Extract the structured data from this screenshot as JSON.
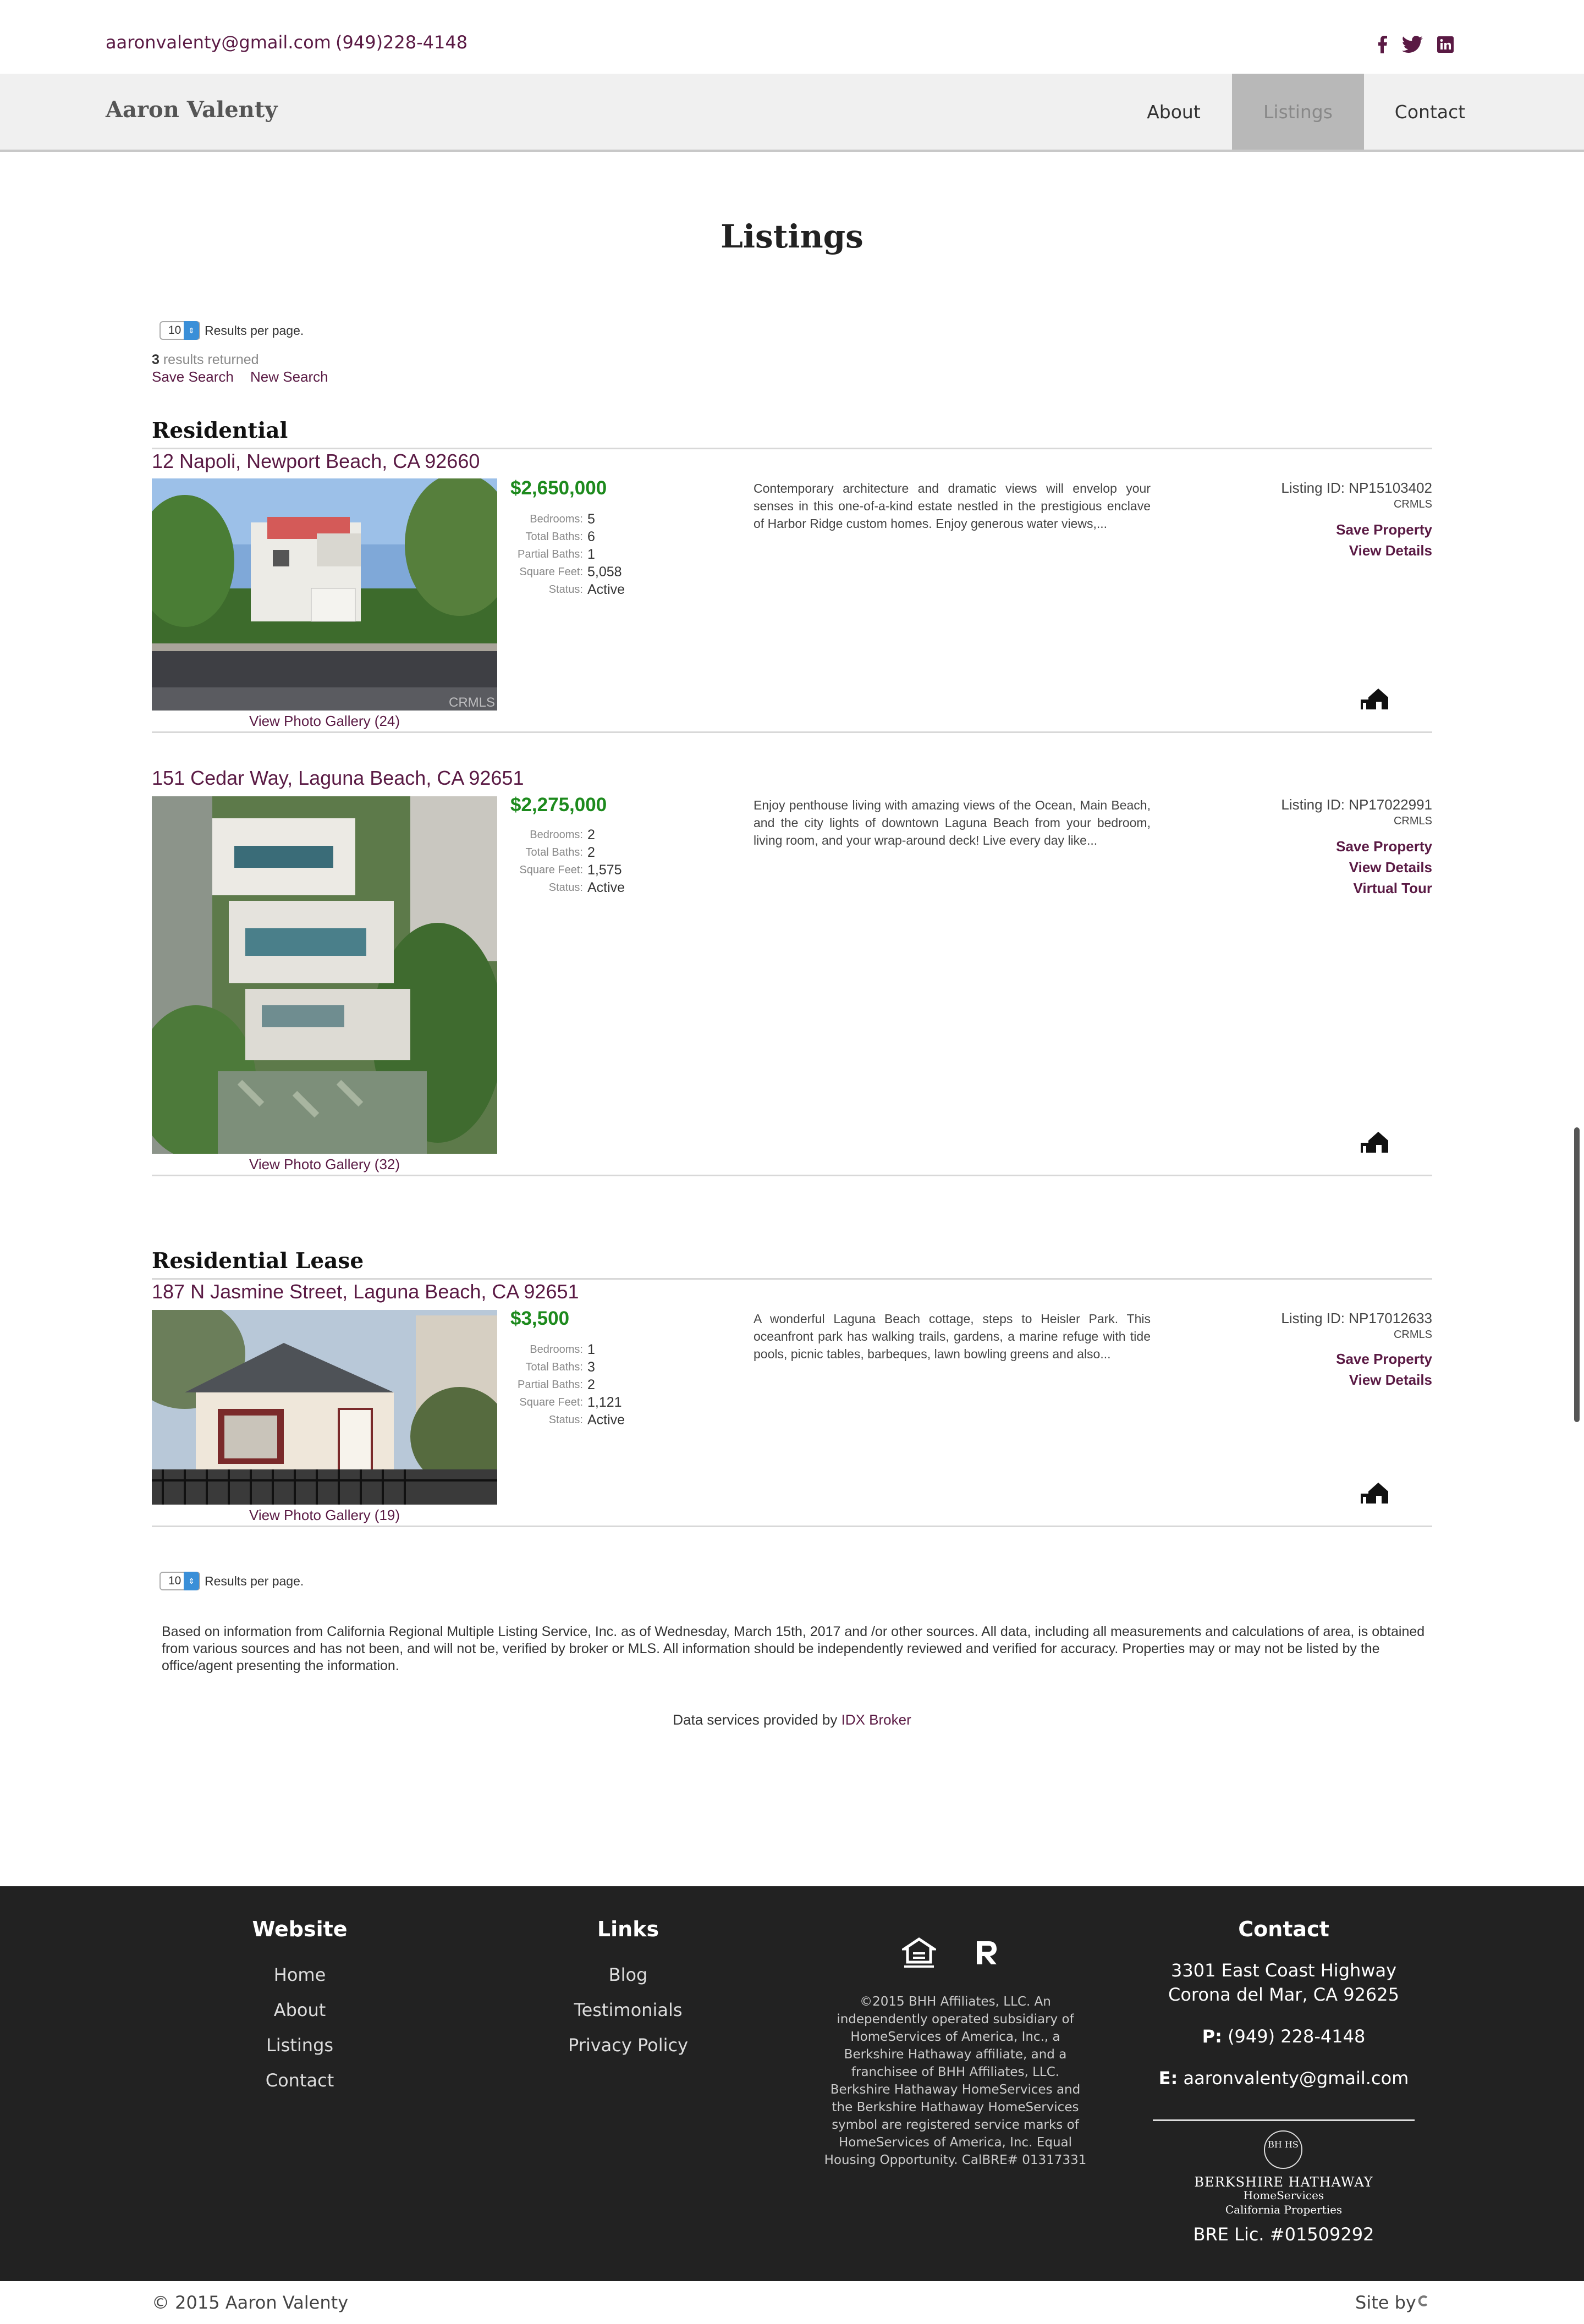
{
  "topbar": {
    "email": "aaronvalenty@gmail.com",
    "phone": "(949)228-4148",
    "social": [
      "facebook-icon",
      "twitter-icon",
      "linkedin-icon"
    ]
  },
  "nav": {
    "brand": "Aaron Valenty",
    "items": [
      "About",
      "Listings",
      "Contact"
    ],
    "active": "Listings"
  },
  "page": {
    "title": "Listings"
  },
  "search": {
    "per_page": "10",
    "per_page_label": "Results per page.",
    "count": "3",
    "count_label": "results returned",
    "save_search": "Save Search",
    "new_search": "New Search"
  },
  "labels": {
    "bedrooms": "Bedrooms:",
    "total_baths": "Total Baths:",
    "partial_baths": "Partial Baths:",
    "square_feet": "Square Feet:",
    "status": "Status:",
    "save_property": "Save Property",
    "view_details": "View Details",
    "virtual_tour": "Virtual Tour",
    "mls": "CRMLS",
    "listing_id_prefix": "Listing ID:"
  },
  "sections": [
    {
      "heading": "Residential"
    },
    {
      "heading": "Residential Lease"
    }
  ],
  "listings": [
    {
      "address": "12 Napoli, Newport Beach, CA 92660",
      "price": "$2,650,000",
      "bedrooms": "5",
      "total_baths": "6",
      "partial_baths": "1",
      "square_feet": "5,058",
      "status": "Active",
      "description": "Contemporary architecture and dramatic views will envelop your senses in this one-of-a-kind estate nestled in the prestigious enclave of Harbor Ridge custom homes. Enjoy generous water views,...",
      "listing_id": "Listing ID: NP15103402",
      "gallery": "View Photo Gallery (24)",
      "photo_watermark": "CRMLS"
    },
    {
      "address": "151 Cedar Way, Laguna Beach, CA 92651",
      "price": "$2,275,000",
      "bedrooms": "2",
      "total_baths": "2",
      "square_feet": "1,575",
      "status": "Active",
      "description": "Enjoy penthouse living with amazing views of the Ocean, Main Beach, and the city lights of downtown Laguna Beach from your bedroom, living room, and your wrap-around deck! Live every day like...",
      "listing_id": "Listing ID: NP17022991",
      "gallery": "View Photo Gallery (32)"
    },
    {
      "address": "187 N Jasmine Street, Laguna Beach, CA 92651",
      "price": "$3,500",
      "bedrooms": "1",
      "total_baths": "3",
      "partial_baths": "2",
      "square_feet": "1,121",
      "status": "Active",
      "description": "A wonderful Laguna Beach cottage, steps to Heisler Park. This oceanfront park has walking trails, gardens, a marine refuge with tide pools, picnic tables, barbeques, lawn bowling greens and also...",
      "listing_id": "Listing ID: NP17012633",
      "gallery": "View Photo Gallery (19)"
    }
  ],
  "disclaimer": "Based on information from California Regional Multiple Listing Service, Inc. as of Wednesday, March 15th, 2017 and /or other sources. All data, including all measurements and calculations of area, is obtained from various sources and has not been, and will not be, verified by broker or MLS. All information should be independently reviewed and verified for accuracy. Properties may or may not be listed by the office/agent presenting the information.",
  "data_services": {
    "text": "Data services provided by",
    "link": "IDX Broker"
  },
  "footer": {
    "website": {
      "heading": "Website",
      "links": [
        "Home",
        "About",
        "Listings",
        "Contact"
      ]
    },
    "links": {
      "heading": "Links",
      "links": [
        "Blog",
        "Testimonials",
        "Privacy Policy"
      ]
    },
    "legal": "©2015 BHH Affiliates, LLC. An independently operated subsidiary of HomeServices of America, Inc., a Berkshire Hathaway affiliate, and a franchisee of BHH Affiliates, LLC. Berkshire Hathaway HomeServices and the Berkshire Hathaway HomeServices symbol are registered service marks of HomeServices of America, Inc. Equal Housing Opportunity. CalBRE# 01317331",
    "contact": {
      "heading": "Contact",
      "address1": "3301 East Coast Highway",
      "address2": "Corona del Mar, CA 92625",
      "phone_label": "P:",
      "phone": "(949) 228-4148",
      "email_label": "E:",
      "email": "aaronvalenty@gmail.com",
      "brand_line1": "BERKSHIRE HATHAWAY",
      "brand_line2": "HomeServices",
      "brand_line3": "California Properties",
      "logo_mark": "BH HS",
      "license": "BRE Lic. #01509292"
    }
  },
  "bottom": {
    "copyright": "© 2015 Aaron Valenty",
    "site_by": "Site by"
  },
  "colors": {
    "accent": "#5a1a44",
    "price": "#1d8a1d",
    "footer_bg": "#222222"
  }
}
